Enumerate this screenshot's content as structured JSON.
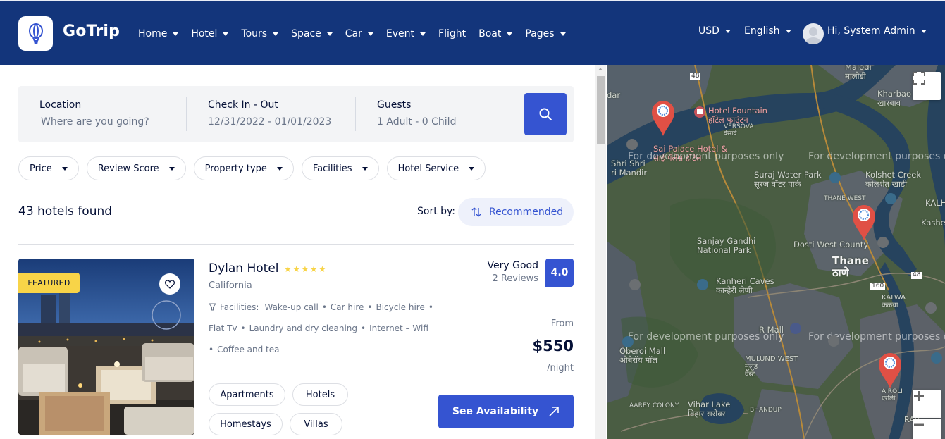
{
  "brand": {
    "name": "GoTrip"
  },
  "nav": {
    "items": [
      {
        "label": "Home",
        "has_dropdown": true
      },
      {
        "label": "Hotel",
        "has_dropdown": true
      },
      {
        "label": "Tours",
        "has_dropdown": true
      },
      {
        "label": "Space",
        "has_dropdown": true
      },
      {
        "label": "Car",
        "has_dropdown": true
      },
      {
        "label": "Event",
        "has_dropdown": true
      },
      {
        "label": "Flight",
        "has_dropdown": false
      },
      {
        "label": "Boat",
        "has_dropdown": true
      },
      {
        "label": "Pages",
        "has_dropdown": true
      }
    ]
  },
  "header_right": {
    "currency": "USD",
    "language": "English",
    "user": "Hi, System Admin"
  },
  "search": {
    "location_label": "Location",
    "location_placeholder": "Where are you going?",
    "dates_label": "Check In - Out",
    "dates_value": "12/31/2022 - 01/01/2023",
    "guests_label": "Guests",
    "guests_value": "1 Adult - 0 Child"
  },
  "filters": [
    "Price",
    "Review Score",
    "Property type",
    "Facilities",
    "Hotel Service"
  ],
  "results": {
    "count_text": "43 hotels found",
    "sort_label": "Sort by:",
    "sort_value": "Recommended"
  },
  "hotel": {
    "badge": "FEATURED",
    "name": "Dylan Hotel",
    "stars": 5,
    "star_glyphs": "★★★★★",
    "location": "California",
    "facilities_label": "Facilities:",
    "facilities": [
      "Wake-up call",
      "Car hire",
      "Bicycle hire",
      "Flat Tv",
      "Laundry and dry cleaning",
      "Internet – Wifi",
      "Coffee and tea"
    ],
    "rating_text": "Very Good",
    "reviews": "2 Reviews",
    "score": "4.0",
    "from_label": "From",
    "price": "$550",
    "per_label": "/night",
    "tags": [
      "Apartments",
      "Hotels",
      "Homestays",
      "Villas"
    ],
    "cta": "See Availability"
  },
  "map": {
    "dev_notice": "For development purposes only",
    "labels": {
      "malodi": "Malodi",
      "malodi_mr": "मालोडी",
      "kharbao": "Kharbao",
      "kharbao_mr": "खारबाव",
      "hotel_fountain": "Hotel Fountain",
      "hotel_fountain_mr": "हॉटेल फाउंटन",
      "versova": "VERSOVA",
      "versova_mr": "वेसावे",
      "sai_palace": "Sai Palace Hotel &",
      "sai_palace_mr": "साई पॅलेस हॉटेल",
      "shri_shri": "Shri Shri",
      "mandir": "ri Mandir",
      "suraj_water_park": "Suraj Water Park",
      "suraj_mr": "सूरज वॉटर पार्क",
      "kolshet_creek": "Kolshet Creek",
      "kolshet_mr": "कोलशेत खाडी",
      "thane_west": "THANE WEST",
      "kalher": "KALHE",
      "kasheli": "Kasheli",
      "sanjay_gandhi": "Sanjay Gandhi",
      "national_park": "National Park",
      "dosti": "Dosti West County",
      "thane": "Thane",
      "thane_mr": "ठाणे",
      "kanheri": "Kanheri Caves",
      "kanheri_mr": "कान्हेरी लेणी",
      "kalwa": "KALWA",
      "kalwa_mr": "कळवा",
      "r_mall": "R Mall",
      "oberoi": "Oberoi Mall",
      "oberoi_mr": "ओबेरॉय मॉल",
      "mulund": "MULUND WEST",
      "mulund_mr": "मुलुंड",
      "mulund_mr2": "वेस्ट",
      "airoli": "AIROLI",
      "airoli_mr": "ऐरोली",
      "aarey": "AAREY COLONY",
      "vihar": "Vihar Lake",
      "vihar_mr": "विहार सरोवर",
      "bhandup": "BHANDUP",
      "rab": "RAB",
      "road_48": "48",
      "road_160": "160"
    }
  },
  "colors": {
    "header_bg": "#13357b",
    "primary": "#3554d1",
    "badge": "#f8d448",
    "pin": "#e05045"
  }
}
